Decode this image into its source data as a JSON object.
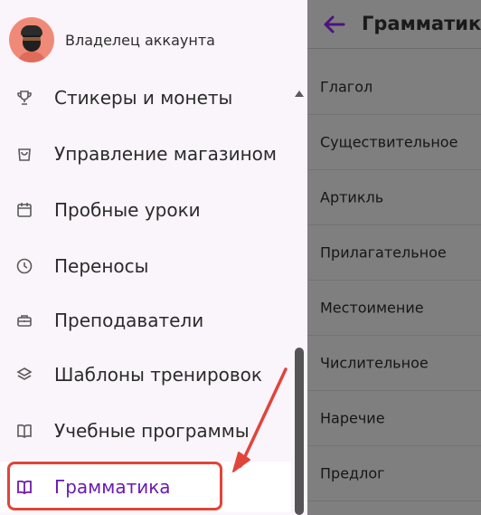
{
  "account": {
    "name": "Владелец аккаунта"
  },
  "nav": {
    "items": [
      {
        "label": "Стикеры и монеты",
        "icon": "trophy-icon"
      },
      {
        "label": "Управление магазином",
        "icon": "shopping-bag-icon"
      },
      {
        "label": "Пробные уроки",
        "icon": "calendar-icon"
      },
      {
        "label": "Переносы",
        "icon": "clock-icon"
      },
      {
        "label": "Преподаватели",
        "icon": "briefcase-icon"
      },
      {
        "label": "Шаблоны тренировок",
        "icon": "layers-icon"
      },
      {
        "label": "Учебные программы",
        "icon": "book-icon"
      },
      {
        "label": "Грамматика",
        "icon": "book-icon",
        "active": true
      }
    ]
  },
  "panel": {
    "title": "Грамматика",
    "items": [
      "Глагол",
      "Существительное",
      "Артикль",
      "Прилагательное",
      "Местоимение",
      "Числительное",
      "Наречие",
      "Предлог"
    ]
  },
  "colors": {
    "accent": "#6a1bb0",
    "annotation": "#e0453b",
    "sidebar_bg": "#faf4fb",
    "overlay": "#7f7f7f"
  }
}
